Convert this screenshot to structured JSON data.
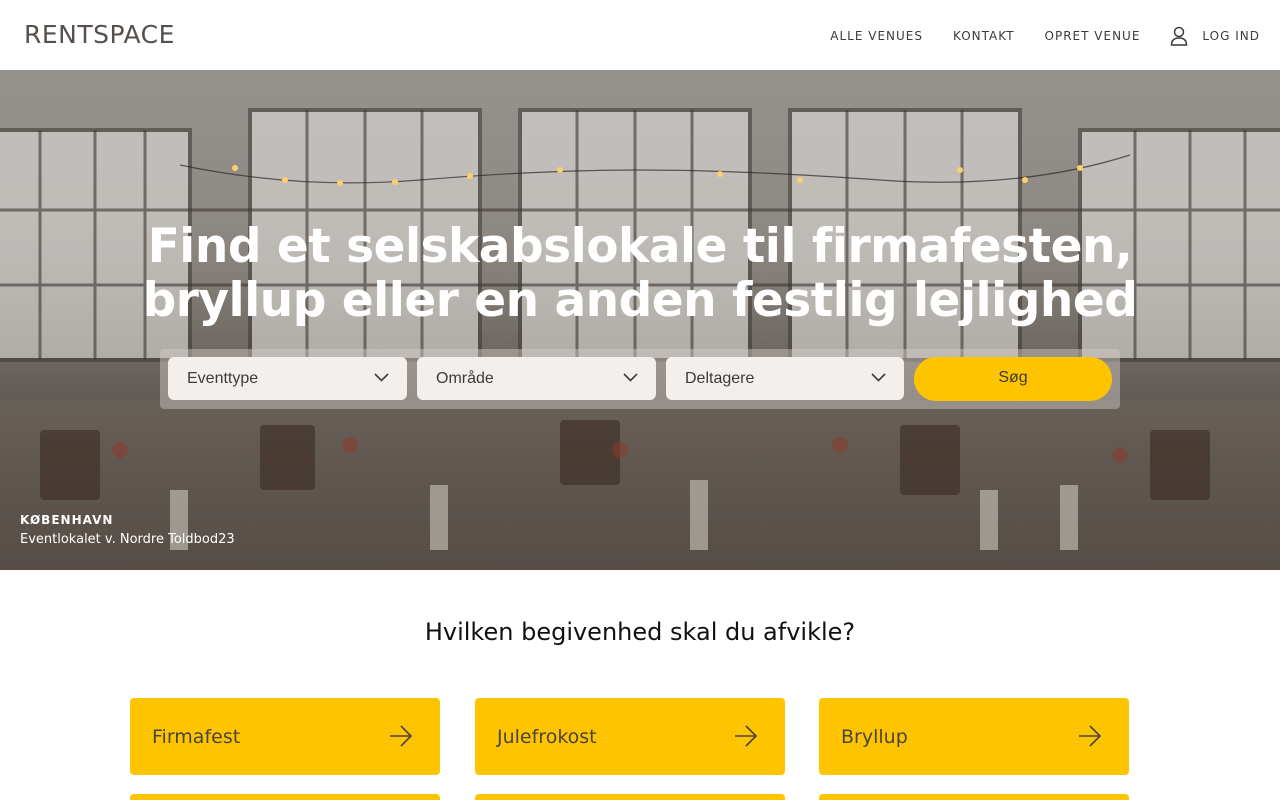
{
  "header": {
    "logo": "RENTSPACE",
    "nav": {
      "all_venues": "ALLE VENUES",
      "contact": "KONTAKT",
      "create_venue": "OPRET VENUE",
      "login": "LOG IND"
    }
  },
  "hero": {
    "title_line1": "Find et selskabslokale til firmafesten,",
    "title_line2": "bryllup eller en anden festlig lejlighed",
    "search": {
      "event_type": "Eventtype",
      "area": "Område",
      "participants": "Deltagere",
      "button": "Søg"
    },
    "caption": {
      "city": "KØBENHAVN",
      "venue": "Eventlokalet v. Nordre Toldbod23"
    }
  },
  "event_section": {
    "title": "Hvilken begivenhed skal du afvikle?",
    "cards": [
      {
        "label": "Firmafest"
      },
      {
        "label": "Julefrokost"
      },
      {
        "label": "Bryllup"
      }
    ]
  },
  "colors": {
    "accent": "#ffc400",
    "text_dark": "#3d3a37",
    "select_bg": "#f3efec"
  },
  "icons": {
    "login": "user-icon",
    "dropdown": "chevron-down-icon",
    "card": "arrow-right-icon"
  }
}
